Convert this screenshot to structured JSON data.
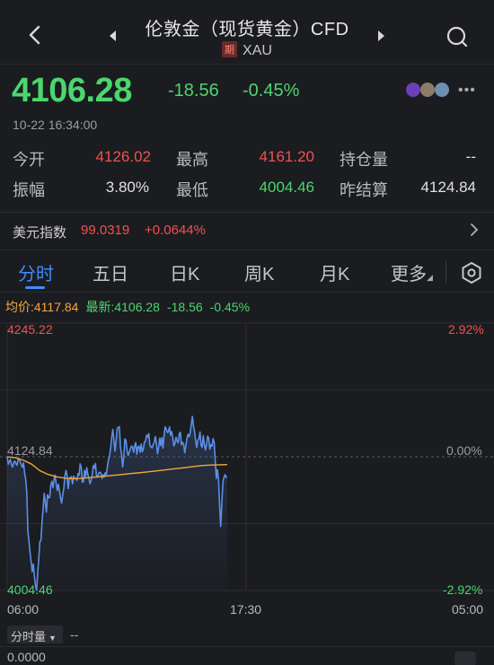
{
  "header": {
    "title": "伦敦金（现货黄金）CFD",
    "tag": "期",
    "symbol": "XAU"
  },
  "quote": {
    "price": "4106.28",
    "change": "-18.56",
    "change_pct": "-0.45%",
    "time": "10-22 16:34:00"
  },
  "stats": {
    "open_label": "今开",
    "open_value": "4126.02",
    "high_label": "最高",
    "high_value": "4161.20",
    "oi_label": "持仓量",
    "oi_value": "--",
    "amp_label": "振幅",
    "amp_value": "3.80%",
    "low_label": "最低",
    "low_value": "4004.46",
    "prev_label": "昨结算",
    "prev_value": "4124.84"
  },
  "index_row": {
    "label": "美元指数",
    "value": "99.0319",
    "change": "+0.0644%"
  },
  "tabs": [
    "分时",
    "五日",
    "日K",
    "周K",
    "月K",
    "更多"
  ],
  "legend": {
    "avg": "均价:4117.84",
    "latest": "最新:4106.28",
    "change": "-18.56",
    "change_pct": "-0.45%"
  },
  "chart_labels": {
    "y_top": "4245.22",
    "y_mid": "4124.84",
    "y_bottom": "4004.46",
    "pct_top": "2.92%",
    "pct_mid": "0.00%",
    "pct_bottom": "-2.92%",
    "x_start": "06:00",
    "x_mid": "17:30",
    "x_end": "05:00"
  },
  "volume": {
    "selector": "分时量",
    "value": "--",
    "zero": "0.0000"
  },
  "colors": {
    "up": "#f0524f",
    "down": "#4bd66e",
    "accent": "#3f8cff",
    "avg_line": "#f3a73b",
    "price_line": "#5b8fe6"
  },
  "chart_data": {
    "type": "line",
    "ylim": [
      4004.46,
      4245.22
    ],
    "reference": 4124.84,
    "x_range": [
      "06:00",
      "05:00"
    ],
    "series": [
      {
        "values": [
          4124.8,
          4118.1,
          4120.7,
          4122.4,
          4117.4,
          4115.6,
          4119.8,
          4121.1,
          4118.6,
          4117.3,
          4122.4,
          4123.1,
          4120.2,
          4117.8,
          4115.4,
          4119.4,
          4110.3,
          4104.4,
          4093.1,
          4058.3,
          4048.9,
          4038.4,
          4030.1,
          4021.4,
          4028.3,
          4017.2,
          4008.8,
          4004.5,
          4020.3,
          4033.1,
          4048.6,
          4049.4,
          4066.3,
          4078.5,
          4091.9,
          4083.9,
          4075.0,
          4090.7,
          4087.8,
          4088.3,
          4099.3,
          4102.8,
          4097.0,
          4104.4,
          4108.4,
          4100.4,
          4094.6,
          4100.1,
          4093.8,
          4087.6,
          4083.1,
          4090.9,
          4096.5,
          4107.7,
          4112.5,
          4107.8,
          4096.2,
          4104.9,
          4106.4,
          4107.0,
          4100.5,
          4107.4,
          4106.1,
          4104.9,
          4103.5,
          4109.8,
          4108.2,
          4118.4,
          4115.3,
          4101.9,
          4102.6,
          4112.6,
          4107.1,
          4115.1,
          4109.1,
          4105.7,
          4100.6,
          4103.2,
          4107.9,
          4116.9,
          4114.6,
          4118.8,
          4107.4,
          4106.4,
          4110.3,
          4111.0,
          4110.3,
          4105.2,
          4108.7,
          4106.6,
          4110.5,
          4108.8,
          4116.1,
          4122.3,
          4126.0,
          4133.0,
          4142.9,
          4149.4,
          4139.6,
          4129.9,
          4139.3,
          4150.2,
          4151.4,
          4151.9,
          4133.3,
          4126.6,
          4115.7,
          4124.9,
          4140.9,
          4139.8,
          4130.6,
          4126.0,
          4128.5,
          4132.1,
          4134.5,
          4134.0,
          4129.0,
          4134.4,
          4137.6,
          4127.2,
          4133.8,
          4134.4,
          4129.0,
          4136.4,
          4129.3,
          4131.9,
          4138.2,
          4139.0,
          4144.3,
          4142.5,
          4145.7,
          4135.3,
          4133.6,
          4132.9,
          4135.9,
          4137.7,
          4143.1,
          4137.2,
          4127.6,
          4133.0,
          4141.7,
          4135.0,
          4142.2,
          4132.7,
          4144.1,
          4151.9,
          4149.8,
          4146.7,
          4147.5,
          4151.7,
          4144.3,
          4147.5,
          4142.2,
          4134.6,
          4136.8,
          4142.5,
          4138.9,
          4137.5,
          4145.8,
          4146.9,
          4135.6,
          4137.8,
          4136.1,
          4128.5,
          4134.7,
          4141.6,
          4145.1,
          4142.9,
          4146.8,
          4154.2,
          4161.2,
          4152.6,
          4147.6,
          4139.5,
          4133.3,
          4139.6,
          4141.2,
          4147.2,
          4135.0,
          4133.4,
          4143.9,
          4136.1,
          4130.9,
          4135.7,
          4143.4,
          4141.5,
          4131.7,
          4135.7,
          4134.3,
          4141.2,
          4137.7,
          4121.1,
          4105.3,
          4113.4,
          4104.6,
          4081.3,
          4062.1,
          4082.2,
          4102.0,
          4106.3,
          4108.8,
          4106.4,
          4106.3
        ]
      },
      {
        "values": [
          4124.8,
          4124.0,
          4121.7,
          4118.2,
          4112.4,
          4109.0,
          4106.9,
          4105.7,
          4105.1,
          4105.4,
          4106.0,
          4106.7,
          4107.4,
          4108.1,
          4108.8,
          4109.6,
          4110.3,
          4111.1,
          4111.9,
          4112.7,
          4113.6,
          4114.4,
          4115.3,
          4116.2,
          4117.0,
          4117.4,
          4117.6,
          4117.8
        ]
      }
    ]
  }
}
